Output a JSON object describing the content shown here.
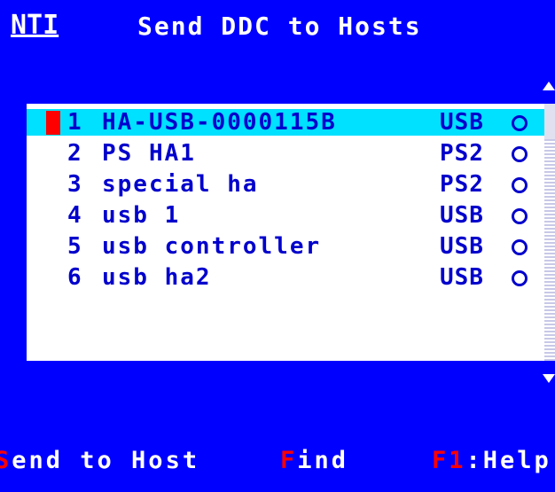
{
  "header": {
    "logo": "NTI",
    "title": "Send DDC to Hosts"
  },
  "hosts": [
    {
      "num": "1",
      "name": "HA-USB-0000115B",
      "type": "USB",
      "selected": true
    },
    {
      "num": "2",
      "name": "PS HA1",
      "type": "PS2",
      "selected": false
    },
    {
      "num": "3",
      "name": "special ha",
      "type": "PS2",
      "selected": false
    },
    {
      "num": "4",
      "name": "usb 1",
      "type": "USB",
      "selected": false
    },
    {
      "num": "5",
      "name": "usb controller",
      "type": "USB",
      "selected": false
    },
    {
      "num": "6",
      "name": "usb ha2",
      "type": "USB",
      "selected": false
    }
  ],
  "footer": {
    "send": {
      "key": "S",
      "rest": "end to Host"
    },
    "find": {
      "key": "F",
      "rest": "ind"
    },
    "help": {
      "key": "F1",
      "rest": ":Help"
    }
  },
  "colors": {
    "background": "#0000ff",
    "selection": "#00e0ff",
    "hotkey": "#ff0000",
    "list_text": "#0000cc"
  }
}
